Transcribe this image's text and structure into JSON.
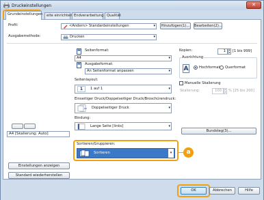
{
  "window": {
    "title": "Druckeinstellungen",
    "close_symbol": "✕"
  },
  "tabs": [
    {
      "label": "Grundeinstellungen"
    },
    {
      "label": "eite einrichten"
    },
    {
      "label": "Endverarbeitung"
    },
    {
      "label": "Qualität"
    }
  ],
  "profile": {
    "label": "Profil:",
    "value": "<Ändern> Standardeinstellungen",
    "add_button": "Hinzufügen(1)...",
    "edit_button": "Bearbeiten(2)..."
  },
  "output": {
    "label": "Ausgabemethode:",
    "value": "Drucken"
  },
  "page_size": {
    "label": "Seitenformat:",
    "value": "A4"
  },
  "output_size": {
    "label": "Ausgabeformat:",
    "value": "An Seitenformat anpassen"
  },
  "copies": {
    "label": "Kopien:",
    "value": "1",
    "range": "[1 bis 999]"
  },
  "orientation": {
    "label": "Ausrichtung",
    "portrait": "Hochformat",
    "landscape": "Querformat",
    "selected": "Hochformat",
    "portrait_letter": "A",
    "landscape_letter": "A"
  },
  "layout": {
    "label": "Seitenlayout:",
    "value": "1 auf 1",
    "icon_digit": "1"
  },
  "manual_scaling": {
    "label": "Manuelle Skalierung",
    "checked": false,
    "scaling_label": "Skalierung:",
    "scaling_value": "100",
    "scaling_range": "% [25 bis 200]"
  },
  "duplex": {
    "label": "Einseitiger Druck/Doppelseitiger Druck/Broschürendruck:",
    "value": "Doppelseitiger Druck"
  },
  "binding": {
    "label": "Bindung:",
    "value": "Lange Seite [links]",
    "button": "Bundsteg(3)..."
  },
  "sorting": {
    "label": "Sortieren/Gruppieren:",
    "value": "Sortieren"
  },
  "preview": {
    "caption": "A4 [Skalierung: Auto]"
  },
  "left_buttons": {
    "show_settings": "Einstellungen anzeigen",
    "restore_defaults": "Standard wiederherstellen"
  },
  "callout": {
    "letter": "a"
  },
  "footer": {
    "ok": "OK",
    "cancel": "Abbrechen",
    "help": "Hilfe"
  },
  "colors": {
    "highlight": "#f0a010",
    "window_frame": "#cfdceb",
    "selected_tab": "#ffffff"
  }
}
